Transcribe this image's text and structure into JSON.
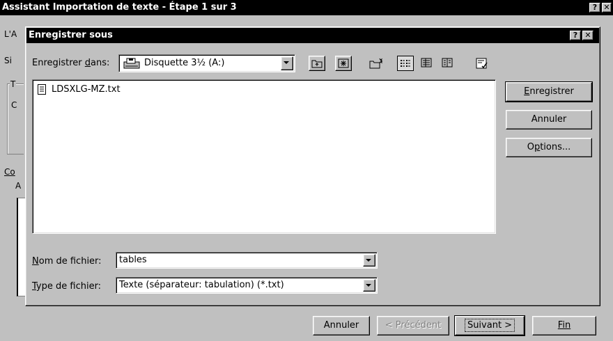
{
  "background_window": {
    "title": "Assistant Importation de texte - Étape 1 sur 3",
    "help_label": "?",
    "close_label": "✕",
    "left_fragments": [
      "L'A",
      "Si",
      "T",
      "C",
      "Co",
      "A"
    ],
    "buttons": {
      "cancel": "Annuler",
      "previous": "< Précédent",
      "next": "Suivant >",
      "finish": "Fin"
    }
  },
  "dialog": {
    "title": "Enregistrer sous",
    "help_label": "?",
    "close_label": "✕",
    "save_in": {
      "label_before": "Enregistrer ",
      "label_accel": "d",
      "label_after": "ans:",
      "value": "Disquette 3½ (A:)",
      "icon": "floppy-drive-icon"
    },
    "toolbar": [
      "up-one-level-icon",
      "desktop-icon",
      "new-folder-icon",
      "list-view-icon",
      "details-view-icon",
      "properties-view-icon",
      "commands-icon"
    ],
    "files": [
      {
        "name": "LDSXLG-MZ.txt",
        "icon": "text-file-icon"
      }
    ],
    "buttons": {
      "save_accel": "E",
      "save_rest": "nregistrer",
      "cancel": "Annuler",
      "options_before": "O",
      "options_accel": "p",
      "options_after": "tions..."
    },
    "filename": {
      "label_accel": "N",
      "label_rest": "om de fichier:",
      "value": "tables"
    },
    "filetype": {
      "label_accel": "T",
      "label_rest": "ype de fichier:",
      "value": "Texte (séparateur: tabulation) (*.txt)"
    }
  }
}
